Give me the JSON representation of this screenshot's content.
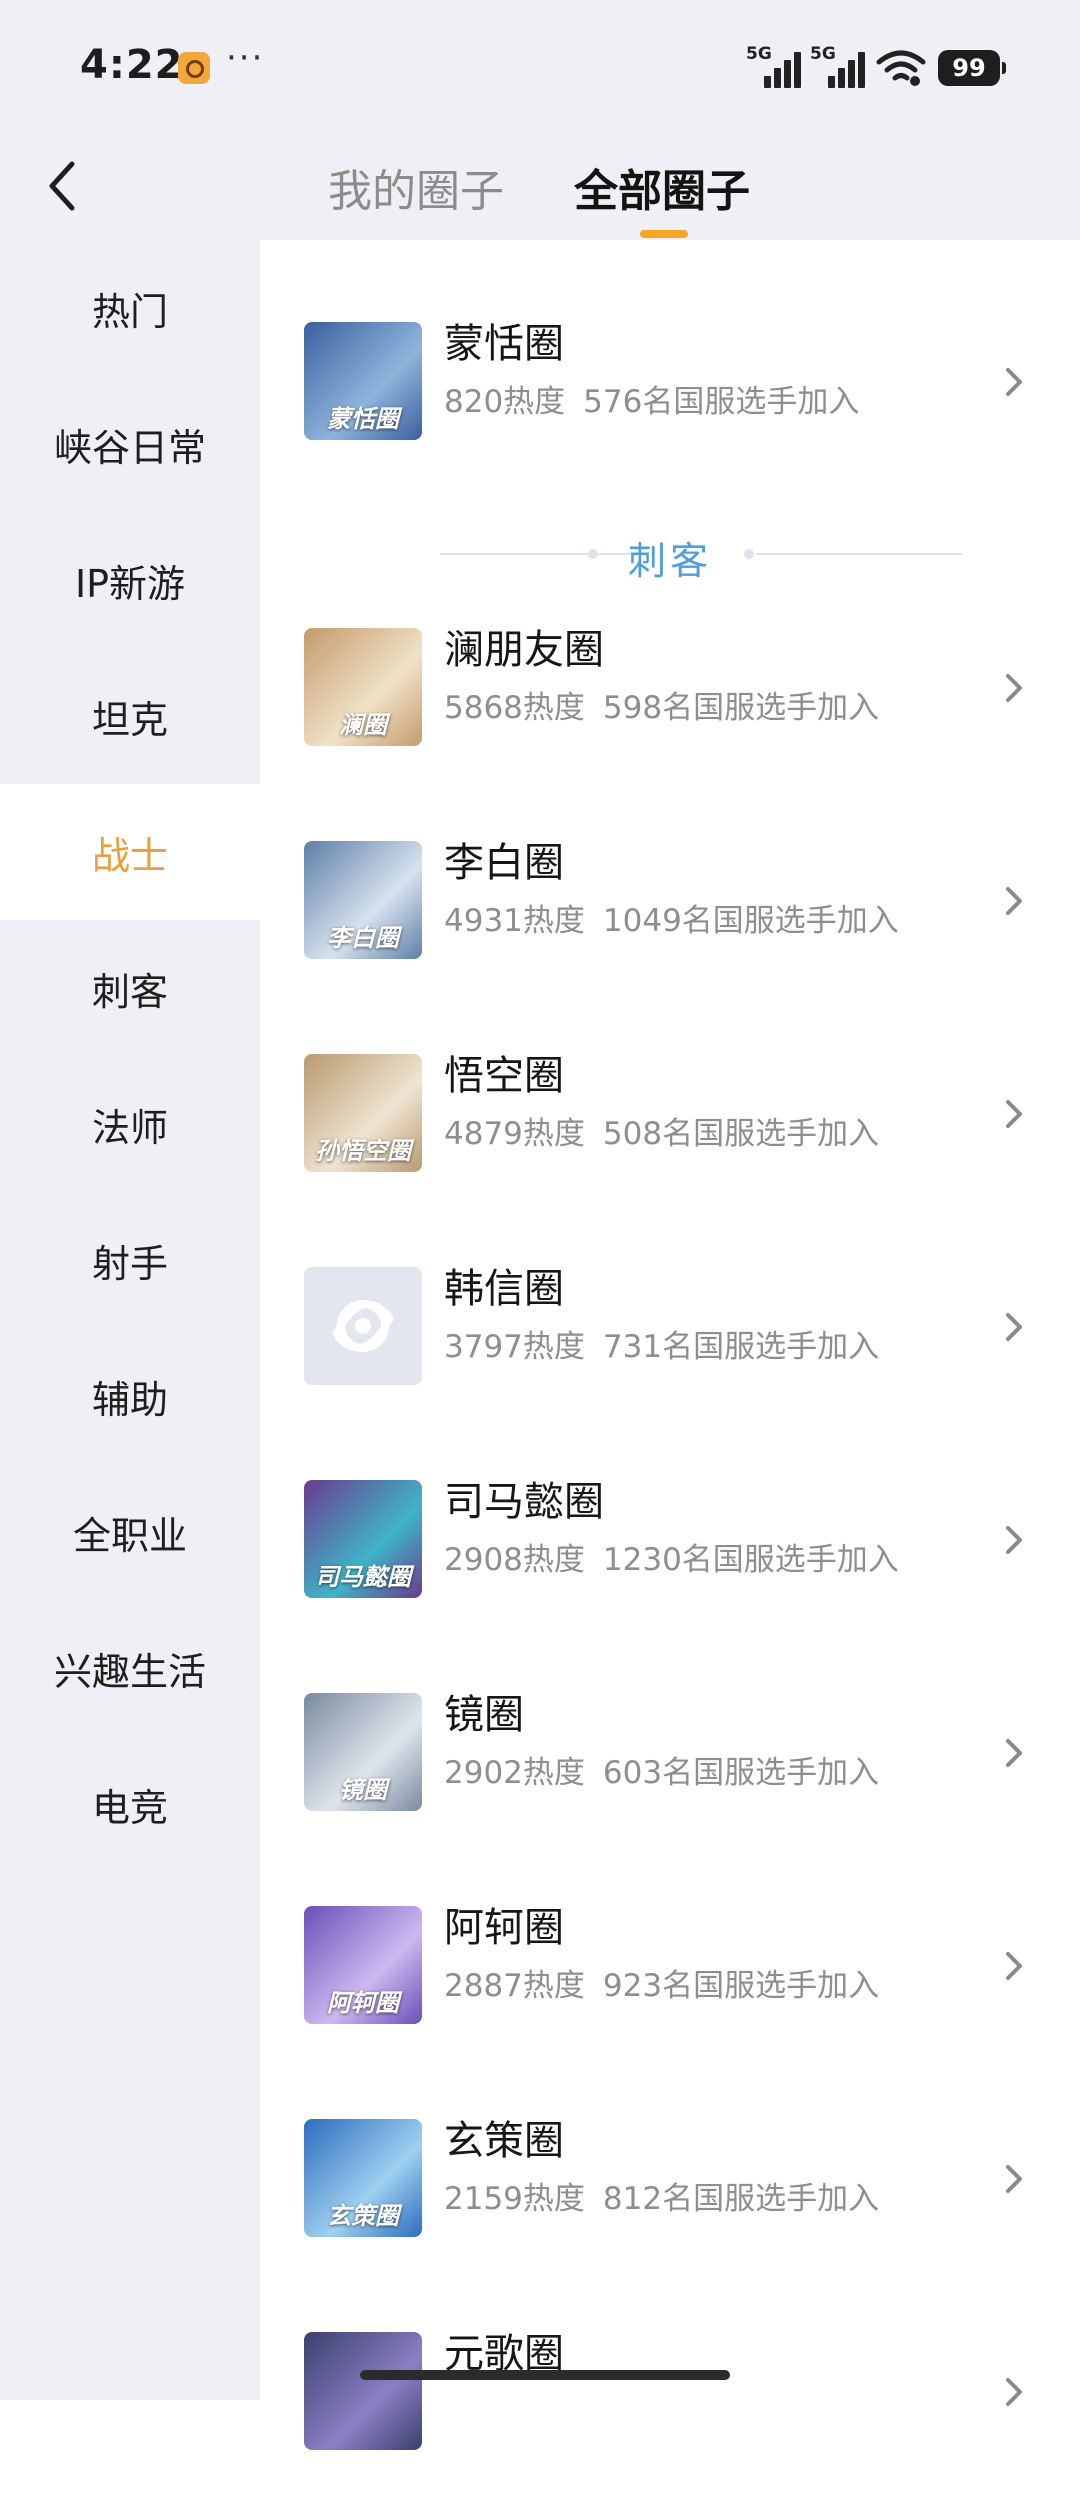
{
  "status_bar": {
    "time": "4:22",
    "app_icon": "game-app-icon",
    "more": "···",
    "network_1": "5G",
    "network_2": "5G",
    "wifi_icon": "wifi-icon",
    "battery": "99"
  },
  "header": {
    "back_icon": "chevron-left-icon",
    "tabs": [
      {
        "label": "我的圈子",
        "active": false
      },
      {
        "label": "全部圈子",
        "active": true
      }
    ],
    "indicator_color": "#f5a623"
  },
  "sidebar": {
    "active_color": "#e8a03d",
    "items": [
      {
        "label": "热门"
      },
      {
        "label": "峡谷日常"
      },
      {
        "label": "IP新游"
      },
      {
        "label": "坦克"
      },
      {
        "label": "战士",
        "active": true
      },
      {
        "label": "刺客"
      },
      {
        "label": "法师"
      },
      {
        "label": "射手"
      },
      {
        "label": "辅助"
      },
      {
        "label": "全职业"
      },
      {
        "label": "兴趣生活"
      },
      {
        "label": "电竞"
      }
    ]
  },
  "list": {
    "section_title": "刺客",
    "section_color": "#4c9ee0",
    "rows": [
      {
        "thumb_label": "蒙恬圈",
        "name": "蒙恬圈",
        "heat": "820热度",
        "members": "576名国服选手加入",
        "colors": [
          "#3b5f9c",
          "#8fb4dc"
        ]
      },
      {
        "thumb_label": "澜圈",
        "name": "澜朋友圈",
        "heat": "5868热度",
        "members": "598名国服选手加入",
        "colors": [
          "#c49a6c",
          "#f1e2c8"
        ]
      },
      {
        "thumb_label": "李白圈",
        "name": "李白圈",
        "heat": "4931热度",
        "members": "1049名国服选手加入",
        "colors": [
          "#5d7fa8",
          "#d8e2ee"
        ]
      },
      {
        "thumb_label": "孙悟空圈",
        "name": "悟空圈",
        "heat": "4879热度",
        "members": "508名国服选手加入",
        "colors": [
          "#b89a6e",
          "#efe4d2"
        ]
      },
      {
        "thumb_label": "",
        "name": "韩信圈",
        "heat": "3797热度",
        "members": "731名国服选手加入",
        "placeholder": true,
        "placeholder_icon": "circle-logo-icon"
      },
      {
        "thumb_label": "司马懿圈",
        "name": "司马懿圈",
        "heat": "2908热度",
        "members": "1230名国服选手加入",
        "colors": [
          "#6a3b8c",
          "#3fb4c8"
        ]
      },
      {
        "thumb_label": "镜圈",
        "name": "镜圈",
        "heat": "2902热度",
        "members": "603名国服选手加入",
        "colors": [
          "#7a8aa0",
          "#dfe5ec"
        ]
      },
      {
        "thumb_label": "阿轲圈",
        "name": "阿轲圈",
        "heat": "2887热度",
        "members": "923名国服选手加入",
        "colors": [
          "#6b4fb8",
          "#cdb8f0"
        ]
      },
      {
        "thumb_label": "玄策圈",
        "name": "玄策圈",
        "heat": "2159热度",
        "members": "812名国服选手加入",
        "colors": [
          "#2d6bbf",
          "#9ed0f0"
        ]
      },
      {
        "thumb_label": "",
        "name": "元歌圈",
        "heat": "",
        "members": "",
        "colors": [
          "#3a3f6e",
          "#8b7fc4"
        ]
      }
    ]
  }
}
